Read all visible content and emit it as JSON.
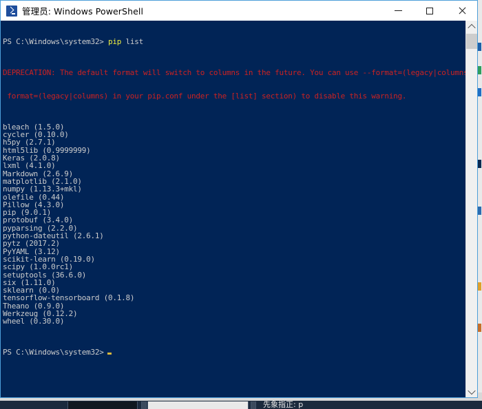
{
  "window": {
    "title": "管理员: Windows PowerShell",
    "app_icon": "powershell-icon",
    "controls": {
      "minimize": "–",
      "maximize": "□",
      "close": "✕"
    }
  },
  "console": {
    "prompt": "PS C:\\Windows\\system32>",
    "command": "pip list",
    "command_name": "pip",
    "command_args": "list",
    "deprecation_line_1": "DEPRECATION: The default format will switch to columns in the future. You can use --format=(legacy|columns) (or define a",
    "deprecation_line_2": " format=(legacy|columns) in your pip.conf under the [list] section) to disable this warning.",
    "final_prompt": "PS C:\\Windows\\system32>",
    "cursor": "block-cursor",
    "colors": {
      "background": "#012456",
      "foreground": "#cccccc",
      "command": "#efef3f",
      "error": "#cc2222",
      "cursor": "#d8b93c"
    },
    "packages": [
      {
        "name": "bleach",
        "version": "1.5.0"
      },
      {
        "name": "cycler",
        "version": "0.10.0"
      },
      {
        "name": "h5py",
        "version": "2.7.1"
      },
      {
        "name": "html5lib",
        "version": "0.9999999"
      },
      {
        "name": "Keras",
        "version": "2.0.8"
      },
      {
        "name": "lxml",
        "version": "4.1.0"
      },
      {
        "name": "Markdown",
        "version": "2.6.9"
      },
      {
        "name": "matplotlib",
        "version": "2.1.0"
      },
      {
        "name": "numpy",
        "version": "1.13.3+mkl"
      },
      {
        "name": "olefile",
        "version": "0.44"
      },
      {
        "name": "Pillow",
        "version": "4.3.0"
      },
      {
        "name": "pip",
        "version": "9.0.1"
      },
      {
        "name": "protobuf",
        "version": "3.4.0"
      },
      {
        "name": "pyparsing",
        "version": "2.2.0"
      },
      {
        "name": "python-dateutil",
        "version": "2.6.1"
      },
      {
        "name": "pytz",
        "version": "2017.2"
      },
      {
        "name": "PyYAML",
        "version": "3.12"
      },
      {
        "name": "scikit-learn",
        "version": "0.19.0"
      },
      {
        "name": "scipy",
        "version": "1.0.0rc1"
      },
      {
        "name": "setuptools",
        "version": "36.6.0"
      },
      {
        "name": "six",
        "version": "1.11.0"
      },
      {
        "name": "sklearn",
        "version": "0.0"
      },
      {
        "name": "tensorflow-tensorboard",
        "version": "0.1.8"
      },
      {
        "name": "Theano",
        "version": "0.9.0"
      },
      {
        "name": "Werkzeug",
        "version": "0.12.2"
      },
      {
        "name": "wheel",
        "version": "0.30.0"
      }
    ]
  },
  "scrollbar": {
    "up_arrow": "chevron-up-icon",
    "down_arrow": "chevron-down-icon"
  },
  "taskbar": {
    "text": "先象指正: p"
  }
}
